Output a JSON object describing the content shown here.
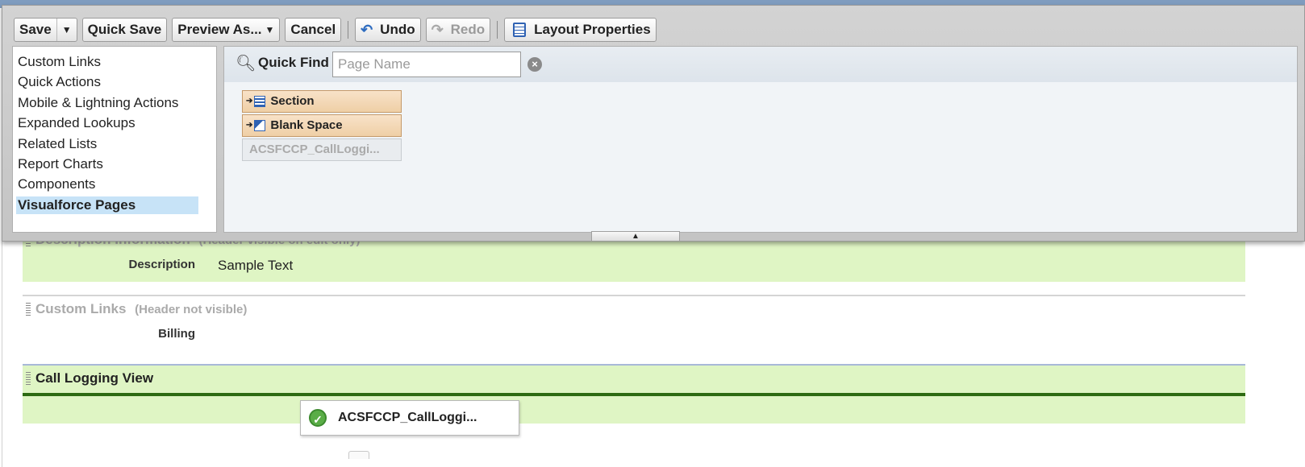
{
  "toolbar": {
    "save_label": "Save",
    "quick_save_label": "Quick Save",
    "preview_as_label": "Preview As...",
    "cancel_label": "Cancel",
    "undo_label": "Undo",
    "redo_label": "Redo",
    "layout_properties_label": "Layout Properties"
  },
  "categories": {
    "items": [
      {
        "label": "Custom Links"
      },
      {
        "label": "Quick Actions"
      },
      {
        "label": "Mobile & Lightning Actions"
      },
      {
        "label": "Expanded Lookups"
      },
      {
        "label": "Related Lists"
      },
      {
        "label": "Report Charts"
      },
      {
        "label": "Components"
      },
      {
        "label": "Visualforce Pages",
        "selected": true
      }
    ]
  },
  "quick_find": {
    "label": "Quick Find",
    "placeholder": "Page Name",
    "value": ""
  },
  "palette_items": [
    {
      "label": "Section",
      "icon": "section-icon"
    },
    {
      "label": "Blank Space",
      "icon": "blank-space-icon"
    },
    {
      "label": "ACSFCCP_CallLoggi...",
      "disabled": true
    }
  ],
  "layout": {
    "description_section": {
      "title": "Description Information",
      "subtitle": "(Header visible on edit only)",
      "field_label": "Description",
      "field_value": "Sample Text"
    },
    "custom_links_section": {
      "title": "Custom Links",
      "subtitle": "(Header not visible)",
      "field_label": "Billing"
    },
    "call_logging_section": {
      "title": "Call Logging View",
      "vf_page_label": "ACSFCCP_CallLoggi..."
    }
  },
  "colors": {
    "section_green": "#dff5c4",
    "selected_category": "#c7e3f7",
    "palette_item": "#efcfa6",
    "call_bar": "#2d6a12"
  }
}
